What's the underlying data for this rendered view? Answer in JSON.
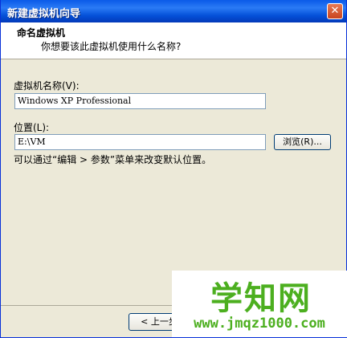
{
  "window": {
    "title": "新建虚拟机向导"
  },
  "header": {
    "title": "命名虚拟机",
    "subtitle": "你想要该此虚拟机使用什么名称?"
  },
  "name_field": {
    "label": "虚拟机名称(V):",
    "value": "Windows XP Professional"
  },
  "location_field": {
    "label": "位置(L):",
    "value": "E:\\VM",
    "browse_label": "浏览(R)..."
  },
  "hint": "可以通过“编辑 > 参数”菜单来改变默认位置。",
  "footer": {
    "back_label": "< 上一步"
  },
  "watermark": {
    "big": "学知网",
    "small": "www.jmqz1000.com"
  },
  "colors": {
    "titlebar": "#0a5ae8",
    "dialog_bg": "#ece9d8",
    "watermark": "#4caf1f"
  }
}
